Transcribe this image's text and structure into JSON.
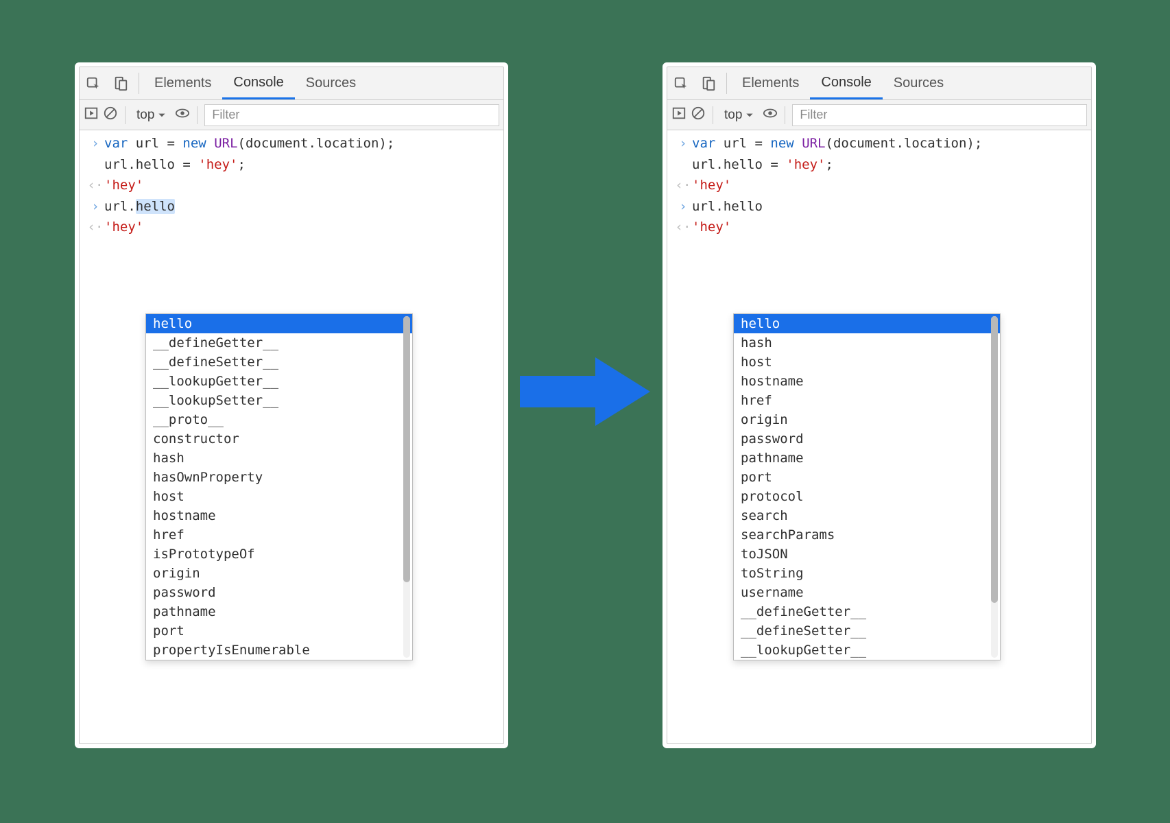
{
  "tabs": {
    "elements": "Elements",
    "console": "Console",
    "sources": "Sources"
  },
  "toolbar": {
    "context": "top",
    "filter_placeholder": "Filter"
  },
  "console": {
    "input1_line1": "var url = new URL(document.location);",
    "input1_line2": "url.hello = 'hey';",
    "output1": "'hey'",
    "input2_prefix": "url.",
    "input2_typed": "hello",
    "output2": "'hey'"
  },
  "autocomplete_left": {
    "selected": "hello",
    "items": [
      "hello",
      "__defineGetter__",
      "__defineSetter__",
      "__lookupGetter__",
      "__lookupSetter__",
      "__proto__",
      "constructor",
      "hash",
      "hasOwnProperty",
      "host",
      "hostname",
      "href",
      "isPrototypeOf",
      "origin",
      "password",
      "pathname",
      "port",
      "propertyIsEnumerable"
    ]
  },
  "autocomplete_right": {
    "selected": "hello",
    "items": [
      "hello",
      "hash",
      "host",
      "hostname",
      "href",
      "origin",
      "password",
      "pathname",
      "port",
      "protocol",
      "search",
      "searchParams",
      "toJSON",
      "toString",
      "username",
      "__defineGetter__",
      "__defineSetter__",
      "__lookupGetter__"
    ]
  }
}
